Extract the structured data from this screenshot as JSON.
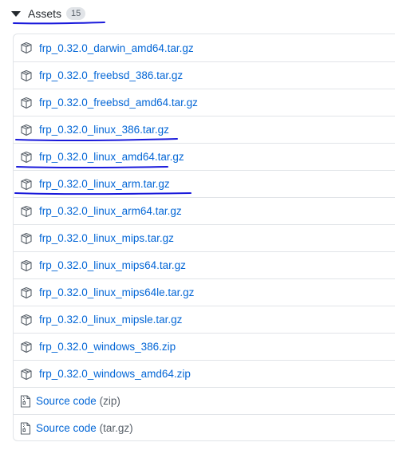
{
  "assets": {
    "title": "Assets",
    "count": "15",
    "files": [
      {
        "name": "frp_0.32.0_darwin_amd64.tar.gz",
        "icon": "package-icon"
      },
      {
        "name": "frp_0.32.0_freebsd_386.tar.gz",
        "icon": "package-icon"
      },
      {
        "name": "frp_0.32.0_freebsd_amd64.tar.gz",
        "icon": "package-icon"
      },
      {
        "name": "frp_0.32.0_linux_386.tar.gz",
        "icon": "package-icon"
      },
      {
        "name": "frp_0.32.0_linux_amd64.tar.gz",
        "icon": "package-icon"
      },
      {
        "name": "frp_0.32.0_linux_arm.tar.gz",
        "icon": "package-icon"
      },
      {
        "name": "frp_0.32.0_linux_arm64.tar.gz",
        "icon": "package-icon"
      },
      {
        "name": "frp_0.32.0_linux_mips.tar.gz",
        "icon": "package-icon"
      },
      {
        "name": "frp_0.32.0_linux_mips64.tar.gz",
        "icon": "package-icon"
      },
      {
        "name": "frp_0.32.0_linux_mips64le.tar.gz",
        "icon": "package-icon"
      },
      {
        "name": "frp_0.32.0_linux_mipsle.tar.gz",
        "icon": "package-icon"
      },
      {
        "name": "frp_0.32.0_windows_386.zip",
        "icon": "package-icon"
      },
      {
        "name": "frp_0.32.0_windows_amd64.zip",
        "icon": "package-icon"
      }
    ],
    "source_code": [
      {
        "label": "Source code",
        "ext": "(zip)",
        "icon": "file-zip-icon"
      },
      {
        "label": "Source code",
        "ext": "(tar.gz)",
        "icon": "file-zip-icon"
      }
    ]
  },
  "colors": {
    "link": "#0366d6",
    "annotation_ink": "#1a1adb",
    "border": "#e1e4e8",
    "counter_bg": "#e1e4e8"
  }
}
